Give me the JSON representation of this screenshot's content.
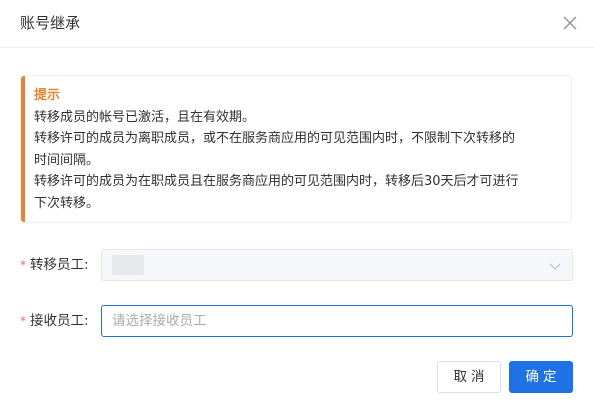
{
  "dialog": {
    "title": "账号继承"
  },
  "notice": {
    "title": "提示",
    "lines": [
      "转移成员的帐号已激活，且在有效期。",
      "转移许可的成员为离职成员，或不在服务商应用的可见范围内时，不限制下次转移的",
      "时间间隔。",
      "转移许可的成员为在职成员且在服务商应用的可见范围内时，转移后30天后才可进行",
      "下次转移。"
    ]
  },
  "form": {
    "transfer_label": "转移员工:",
    "transfer_value": "",
    "receive_label": "接收员工:",
    "receive_placeholder": "请选择接收员工",
    "required_mark": "*"
  },
  "buttons": {
    "cancel": "取消",
    "confirm": "确定"
  },
  "colors": {
    "accent": "#1e72e6",
    "warning": "#e6852f",
    "required": "#f56c6c"
  },
  "icons": {
    "close": "close-icon",
    "dropdown": "chevron-down-icon"
  }
}
